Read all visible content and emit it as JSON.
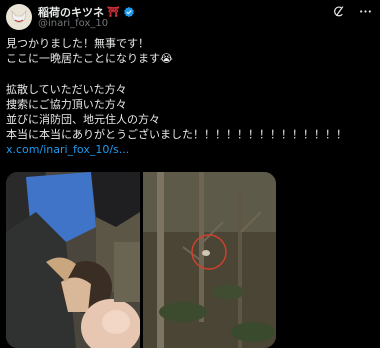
{
  "tweet": {
    "display_name": "稲荷のキツネ",
    "name_emoji": "⛩",
    "handle": "@inari_fox_10",
    "lines": [
      "見つかりました！無事です！",
      "ここに一晩居たことになります😭",
      "",
      "拡散していただいた方々",
      "捜索にご協力頂いた方々",
      "並びに消防団、地元住人の方々",
      "本当に本当にありがとうございました！！！！！！！！！！！！！！"
    ],
    "link": "x.com/inari_fox_10/s..."
  },
  "icons": [
    "avatar-fox-icon",
    "verified-badge-icon",
    "grok-icon",
    "more-icon"
  ],
  "colors": {
    "background": "#000000",
    "text": "#e7e9ea",
    "secondary": "#71767b",
    "accent": "#1d9bf0"
  }
}
